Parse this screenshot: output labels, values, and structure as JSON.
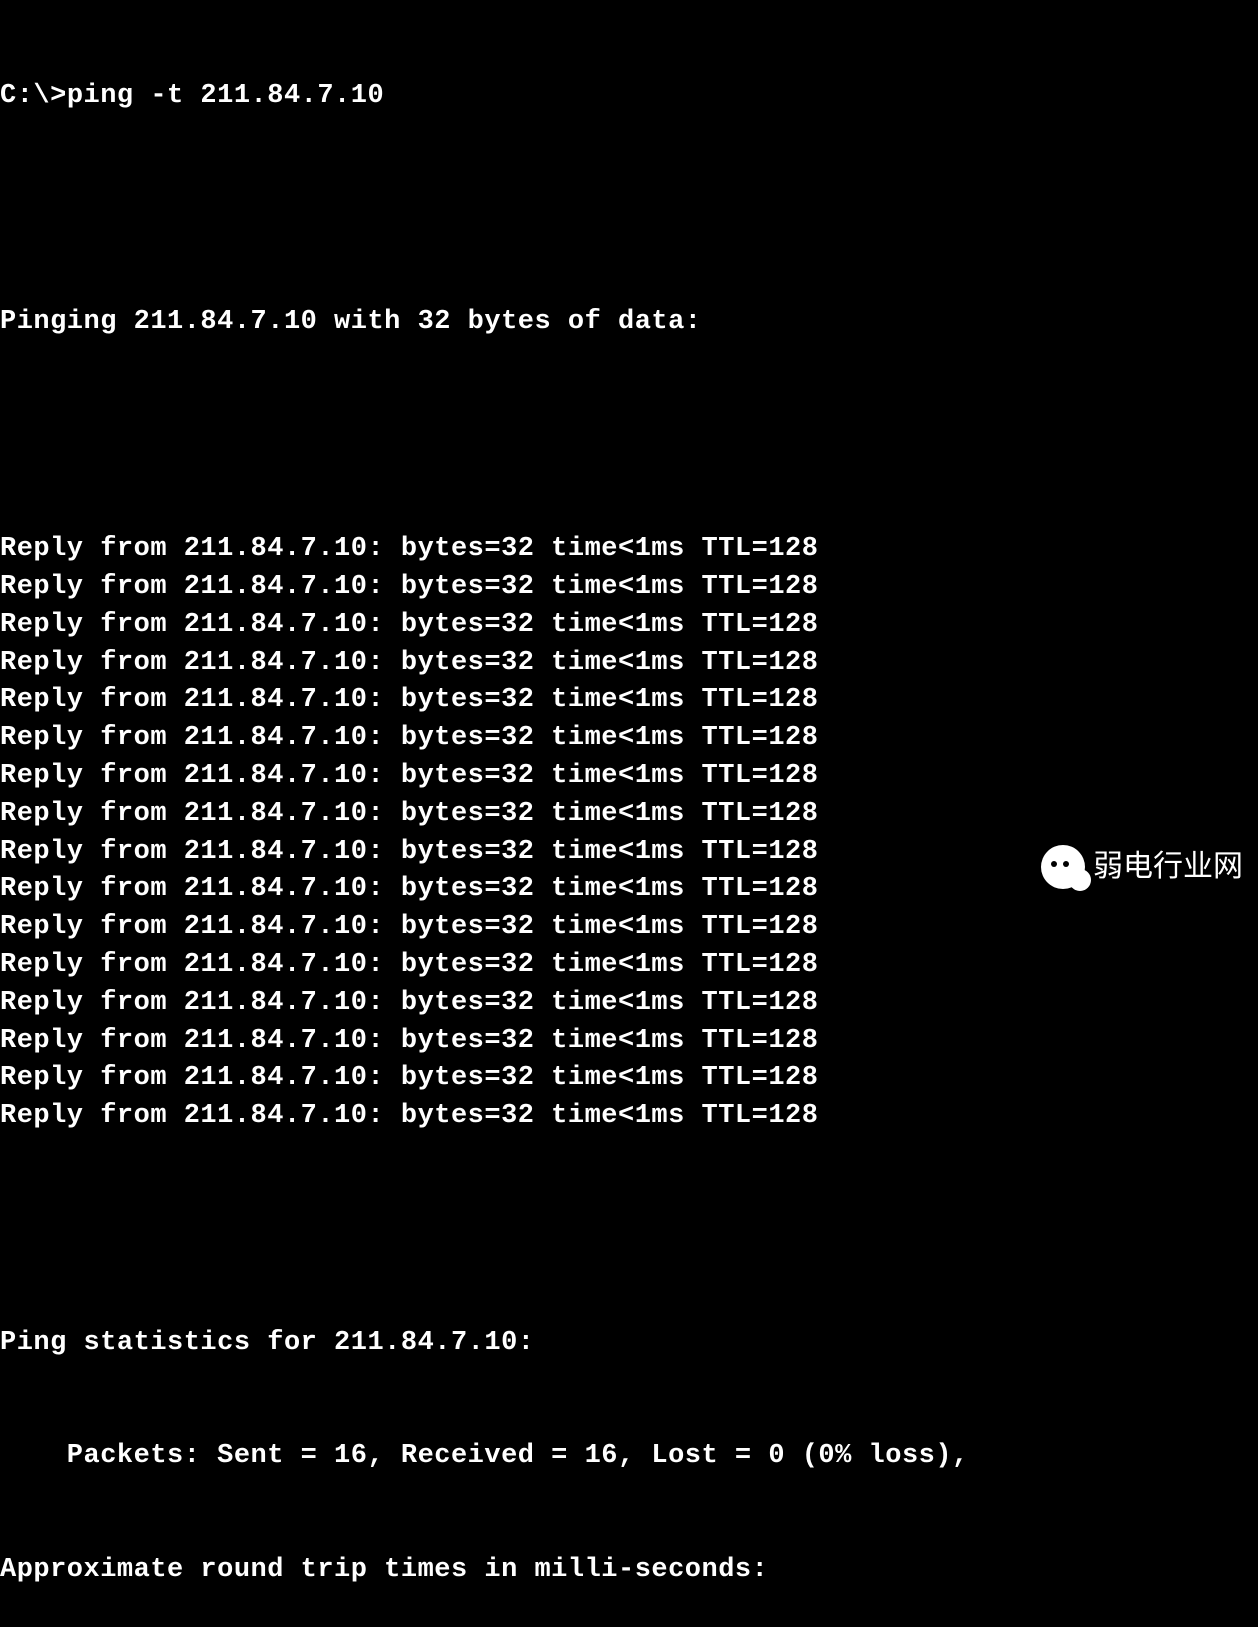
{
  "terminal": {
    "prompt": "C:\\>",
    "command": "ping -t 211.84.7.10",
    "header": "Pinging 211.84.7.10 with 32 bytes of data:",
    "replies": [
      "Reply from 211.84.7.10: bytes=32 time<1ms TTL=128",
      "Reply from 211.84.7.10: bytes=32 time<1ms TTL=128",
      "Reply from 211.84.7.10: bytes=32 time<1ms TTL=128",
      "Reply from 211.84.7.10: bytes=32 time<1ms TTL=128",
      "Reply from 211.84.7.10: bytes=32 time<1ms TTL=128",
      "Reply from 211.84.7.10: bytes=32 time<1ms TTL=128",
      "Reply from 211.84.7.10: bytes=32 time<1ms TTL=128",
      "Reply from 211.84.7.10: bytes=32 time<1ms TTL=128",
      "Reply from 211.84.7.10: bytes=32 time<1ms TTL=128",
      "Reply from 211.84.7.10: bytes=32 time<1ms TTL=128",
      "Reply from 211.84.7.10: bytes=32 time<1ms TTL=128",
      "Reply from 211.84.7.10: bytes=32 time<1ms TTL=128",
      "Reply from 211.84.7.10: bytes=32 time<1ms TTL=128",
      "Reply from 211.84.7.10: bytes=32 time<1ms TTL=128",
      "Reply from 211.84.7.10: bytes=32 time<1ms TTL=128",
      "Reply from 211.84.7.10: bytes=32 time<1ms TTL=128"
    ],
    "stats_header": "Ping statistics for 211.84.7.10:",
    "stats_packets": "    Packets: Sent = 16, Received = 16, Lost = 0 (0% loss),",
    "stats_approx": "Approximate round trip times in milli-seconds:"
  },
  "watermark": {
    "text": "弱电行业网"
  }
}
